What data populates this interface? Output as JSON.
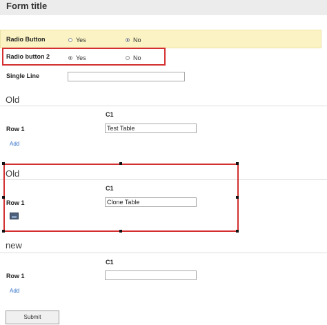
{
  "form": {
    "title": "Form title"
  },
  "radio_button_1": {
    "label": "Radio Button",
    "options": [
      {
        "label": "Yes",
        "selected": false
      },
      {
        "label": "No",
        "selected": true
      }
    ]
  },
  "radio_button_2": {
    "label": "Radio button 2",
    "options": [
      {
        "label": "Yes",
        "selected": true
      },
      {
        "label": "No",
        "selected": false
      }
    ]
  },
  "single_line": {
    "label": "Single Line",
    "value": ""
  },
  "sections": [
    {
      "title": "Old",
      "column": "C1",
      "row_label": "Row 1",
      "cell_value": "Test Table",
      "add_label": "Add"
    },
    {
      "title": "Old",
      "column": "C1",
      "row_label": "Row 1",
      "cell_value": "Clone Table"
    },
    {
      "title": "new",
      "column": "C1",
      "row_label": "Row 1",
      "cell_value": "",
      "add_label": "Add"
    }
  ],
  "submit_label": "Submit",
  "colors": {
    "highlight": "#fbf3c3",
    "red_outline": "#d32f2f",
    "link": "#2a6cc7"
  },
  "icons": {
    "clone_image": "image-placeholder-icon"
  }
}
